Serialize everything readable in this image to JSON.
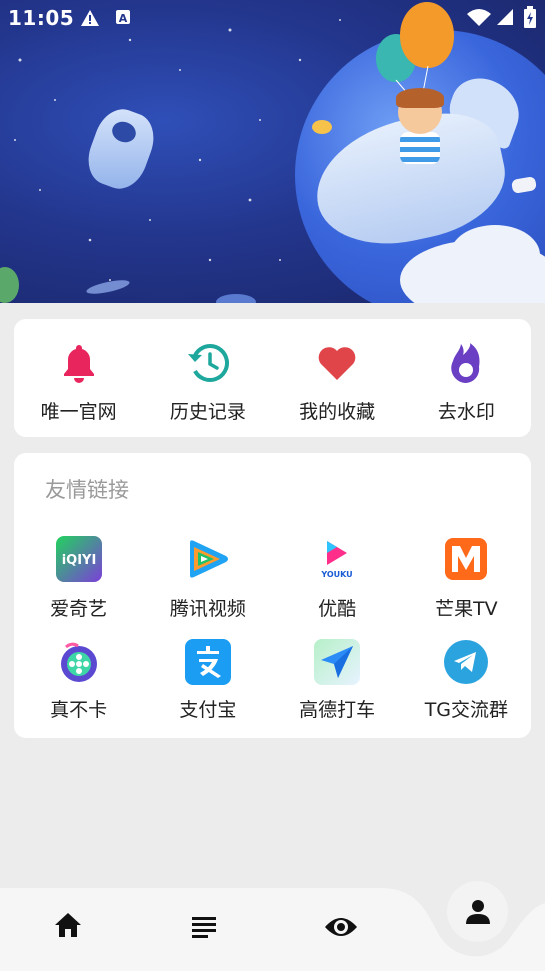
{
  "status_bar": {
    "time": "11:05",
    "icons": [
      "alert-icon",
      "a-box-icon",
      "wifi-icon",
      "signal-icon",
      "battery-icon"
    ]
  },
  "banner": {
    "description_icons": [
      "astronaut",
      "balloons",
      "whale",
      "boy",
      "planet"
    ]
  },
  "quick_actions": [
    {
      "label": "唯一官网",
      "icon": "bell-icon",
      "color": "#e8265d"
    },
    {
      "label": "历史记录",
      "icon": "history-icon",
      "color": "#1ea79c"
    },
    {
      "label": "我的收藏",
      "icon": "heart-icon",
      "color": "#e0454a"
    },
    {
      "label": "去水印",
      "icon": "flame-icon",
      "color": "#6a3fc4"
    }
  ],
  "links_section": {
    "title": "友情链接",
    "items": [
      {
        "label": "爱奇艺",
        "icon": "iqiyi-icon",
        "color": "#1ec14f"
      },
      {
        "label": "腾讯视频",
        "icon": "tencent-video-icon",
        "color": "#1fa3f2"
      },
      {
        "label": "优酷",
        "icon": "youku-icon",
        "color": "#ff2e8a"
      },
      {
        "label": "芒果TV",
        "icon": "mango-tv-icon",
        "color": "#ff6a1a"
      },
      {
        "label": "真不卡",
        "icon": "film-reel-icon",
        "color": "#5b4ad1"
      },
      {
        "label": "支付宝",
        "icon": "alipay-icon",
        "color": "#1a9df2"
      },
      {
        "label": "高德打车",
        "icon": "amap-icon",
        "color": "#2b8cf7"
      },
      {
        "label": "TG交流群",
        "icon": "telegram-icon",
        "color": "#2aa3df"
      }
    ]
  },
  "bottom_nav": {
    "items": [
      "home-icon",
      "list-icon",
      "eye-icon"
    ],
    "fab": "person-icon"
  },
  "colors": {
    "background": "#ececec",
    "card": "#ffffff",
    "nav_bar": "#f6f6f6"
  }
}
